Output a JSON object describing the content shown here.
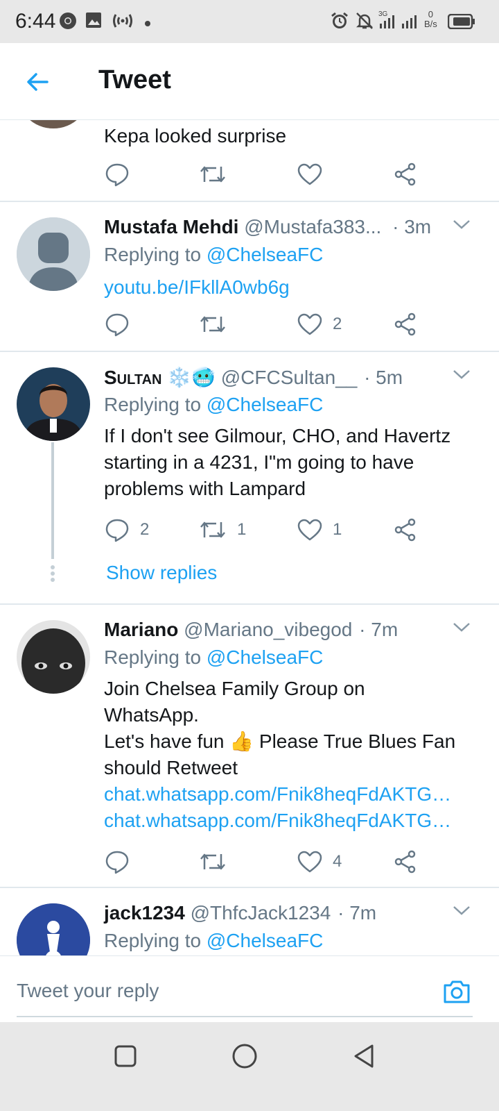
{
  "status_bar": {
    "time": "6:44",
    "net_speed_top": "0",
    "net_speed_unit": "B/s",
    "signal_label": "3G",
    "icons": [
      "chrome-icon",
      "image-icon",
      "wireless-icon",
      "dot-icon",
      "alarm-icon",
      "mute-icon",
      "signal-icon",
      "battery-icon"
    ]
  },
  "header": {
    "title": "Tweet"
  },
  "tweets": [
    {
      "body": "Kepa looked surprise",
      "actions": {
        "reply": "",
        "retweet": "",
        "like": ""
      }
    },
    {
      "name": "Mustafa Mehdi",
      "handle": "@Mustafa383...",
      "time": "· 3m",
      "replying_prefix": "Replying to ",
      "replying_to": "@ChelseaFC",
      "link1": "youtu.be/IFkllA0wb6g",
      "actions": {
        "reply": "",
        "retweet": "",
        "like": "2"
      }
    },
    {
      "name": "Sultan",
      "name_emoji": "❄️🥶",
      "handle": "@CFCSultan__",
      "time": "· 5m",
      "replying_prefix": "Replying to ",
      "replying_to": "@ChelseaFC",
      "body1": "If I don't see Gilmour, CHO, and Havertz",
      "body2": "starting in a 4231, I\"m going to have",
      "body3": "problems with Lampard",
      "actions": {
        "reply": "2",
        "retweet": "1",
        "like": "1"
      },
      "show_replies": "Show replies"
    },
    {
      "name": "Mariano",
      "handle": "@Mariano_vibegod",
      "time": "· 7m",
      "replying_prefix": "Replying to ",
      "replying_to": "@ChelseaFC",
      "body1": "Join Chelsea Family Group on",
      "body2": "WhatsApp.",
      "body3a": "Let's have fun ",
      "body3_emoji": "👍",
      "body3b": " Please True Blues Fan",
      "body4": "should Retweet",
      "link1": "chat.whatsapp.com/Fnik8heqFdAKTG…",
      "link2": "chat.whatsapp.com/Fnik8heqFdAKTG…",
      "actions": {
        "reply": "",
        "retweet": "",
        "like": "4"
      }
    },
    {
      "name": "jack1234",
      "handle": "@ThfcJack1234",
      "time": "· 7m",
      "replying_prefix": "Replying to ",
      "replying_to": "@ChelseaFC"
    }
  ],
  "composer": {
    "placeholder": "Tweet your reply"
  },
  "colors": {
    "accent": "#1da1f2",
    "secondary_text": "#657786",
    "divider": "#e1e8ed"
  }
}
